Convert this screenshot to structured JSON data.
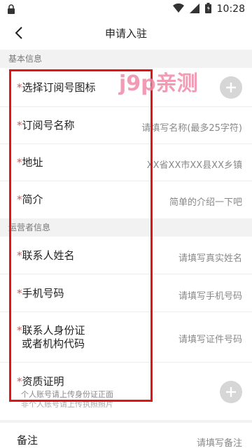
{
  "status_bar": {
    "time": "10:28"
  },
  "nav": {
    "title": "申请入驻"
  },
  "sections": {
    "basic": "基本信息",
    "operator": "运营者信息"
  },
  "basic_rows": {
    "icon": {
      "star": "*",
      "label": "选择订阅号图标"
    },
    "name": {
      "star": "*",
      "label": "订阅号名称",
      "placeholder": "请填写名称(最多25字符)"
    },
    "address": {
      "star": "*",
      "label": "地址",
      "value": "XX省XX市XX县XX乡镇"
    },
    "intro": {
      "star": "*",
      "label": "简介",
      "placeholder": "简单的介绍一下吧"
    }
  },
  "operator_rows": {
    "contact_name": {
      "star": "*",
      "label": "联系人姓名",
      "placeholder": "请填写真实姓名"
    },
    "phone": {
      "star": "*",
      "label": "手机号码",
      "placeholder": "请填写手机号码"
    },
    "id_code": {
      "star": "*",
      "label_line1": "联系人身份证",
      "label_line2": "或者机构代码",
      "placeholder": "请填写证件号码"
    },
    "qualification": {
      "star": "*",
      "label": "资质证明",
      "hint1": "个人账号请上传身份证正面",
      "hint2": "非个人账号请上传执照照片"
    },
    "remark": {
      "label": "备注",
      "placeholder": "请填写备注"
    }
  },
  "watermark": "j9p亲测",
  "colors": {
    "required_star": "#d9534f",
    "highlight_box": "#e21414",
    "watermark": "#f08aa7"
  }
}
